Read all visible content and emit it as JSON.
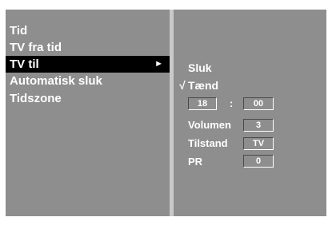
{
  "menu": {
    "items": [
      {
        "label": "Tid"
      },
      {
        "label": "TV fra tid"
      },
      {
        "label": "TV til",
        "arrow": "►"
      },
      {
        "label": "Automatisk sluk"
      },
      {
        "label": "Tidszone"
      }
    ],
    "selected_index": 2
  },
  "submenu": {
    "off_label": "Sluk",
    "on_check": "√",
    "on_label": "Tænd",
    "time": {
      "hour": "18",
      "separator": ":",
      "minute": "00"
    },
    "volume": {
      "label": "Volumen",
      "value": "3"
    },
    "mode": {
      "label": "Tilstand",
      "value": "TV"
    },
    "program": {
      "label": "PR",
      "value": "0"
    }
  },
  "colors": {
    "panel": "#8e8e8e",
    "highlight": "#000000",
    "text": "#ffffff",
    "divider": "#c9c9c9"
  }
}
